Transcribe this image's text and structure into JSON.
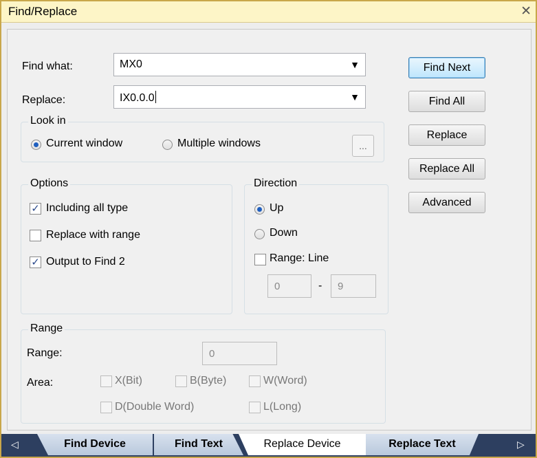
{
  "window": {
    "title": "Find/Replace",
    "close_glyph": "✕"
  },
  "find": {
    "label": "Find what:",
    "value": "MX0"
  },
  "replace": {
    "label": "Replace:",
    "value": "IX0.0.0"
  },
  "combo_arrow": "▼",
  "lookin": {
    "title": "Look in",
    "current_window": "Current window",
    "multiple_windows": "Multiple windows",
    "selected": "current_window",
    "browse_label": "..."
  },
  "options": {
    "title": "Options",
    "including_all_type": {
      "label": "Including all type",
      "checked": true
    },
    "replace_with_range": {
      "label": "Replace with range",
      "checked": false
    },
    "output_to_find2": {
      "label": "Output to Find 2",
      "checked": true
    }
  },
  "direction": {
    "title": "Direction",
    "up": "Up",
    "down": "Down",
    "selected": "up",
    "range_line": {
      "label": "Range: Line",
      "checked": false
    },
    "from": "0",
    "dash": "-",
    "to": "9"
  },
  "range": {
    "title": "Range",
    "range_label": "Range:",
    "range_value": "0",
    "area_label": "Area:",
    "x_bit": "X(Bit)",
    "b_byte": "B(Byte)",
    "w_word": "W(Word)",
    "d_double_word": "D(Double Word)",
    "l_long": "L(Long)"
  },
  "buttons": {
    "find_next": "Find Next",
    "find_all": "Find All",
    "replace": "Replace",
    "replace_all": "Replace All",
    "advanced": "Advanced"
  },
  "tabs": {
    "find_device": "Find Device",
    "find_text": "Find Text",
    "replace_device": "Replace Device",
    "replace_text": "Replace Text",
    "active": "replace_device",
    "left_arrow": "◁",
    "right_arrow": "▷"
  },
  "colors": {
    "title_bar": "#fdf5c7",
    "window_border": "#c9a74a",
    "default_button": "#bee6fd",
    "tab_bar": "#2d3f60"
  }
}
